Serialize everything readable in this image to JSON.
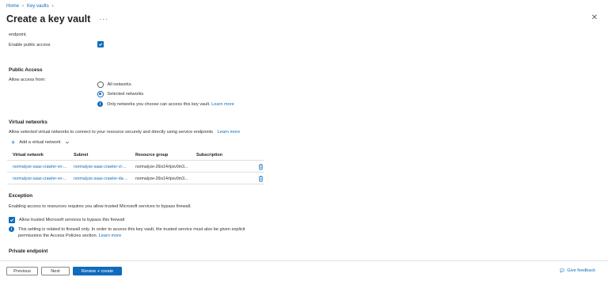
{
  "breadcrumb": {
    "home": "Home",
    "key_vaults": "Key vaults",
    "sep": "›"
  },
  "header": {
    "title": "Create a key vault",
    "more": "···",
    "close": "✕"
  },
  "top": {
    "endpoint_tail": "endpoint.",
    "enable_public_access": "Enable public access",
    "enable_public_access_checked": true
  },
  "public_access": {
    "heading": "Public Access",
    "allow_from_label": "Allow access from:",
    "options": [
      "All networks",
      "Selected networks"
    ],
    "selected": "Selected networks",
    "info_text": "Only networks you choose can access this key vault.",
    "learn_more": "Learn more"
  },
  "virtual_networks": {
    "heading": "Virtual networks",
    "description": "Allow selected virtual networks to connect to your resource securely and directly using service endpoints",
    "learn_more": "Learn more",
    "add_label": "Add a virtual network",
    "columns": [
      "Virtual network",
      "Subnet",
      "Resource group",
      "Subscription"
    ],
    "rows": [
      {
        "vnet": "normalyze-saas-crawler-vn-...",
        "subnet": "normalyze-saas-crawler-cl-...",
        "resource_group": "normalyze-26ix14rlpxv0m3...",
        "subscription": ""
      },
      {
        "vnet": "normalyze-saas-crawler-vn-...",
        "subnet": "normalyze-saas-crawler-da-...",
        "resource_group": "normalyze-26ix14rlpxv0m3...",
        "subscription": ""
      }
    ]
  },
  "exception": {
    "heading": "Exception",
    "description": "Enabling access to resources requires you allow trusted Microsoft services to bypass firewall.",
    "allow_trusted": "Allow trusted Microsoft services to bypass this firewall",
    "allow_trusted_checked": true,
    "info_line1": "This setting is related to firewall only. In order to access this key vault, the trusted service must also be given explicit",
    "info_line2": "permissions the Access Policies section.",
    "learn_more": "Learn more"
  },
  "private_endpoint": {
    "heading": "Private endpoint"
  },
  "footer": {
    "previous": "Previous",
    "next": "Next",
    "review_create": "Review + create",
    "give_feedback": "Give feedback"
  },
  "colors": {
    "accent": "#0f6cbd",
    "text": "#323130",
    "border": "#e1dfdd"
  }
}
